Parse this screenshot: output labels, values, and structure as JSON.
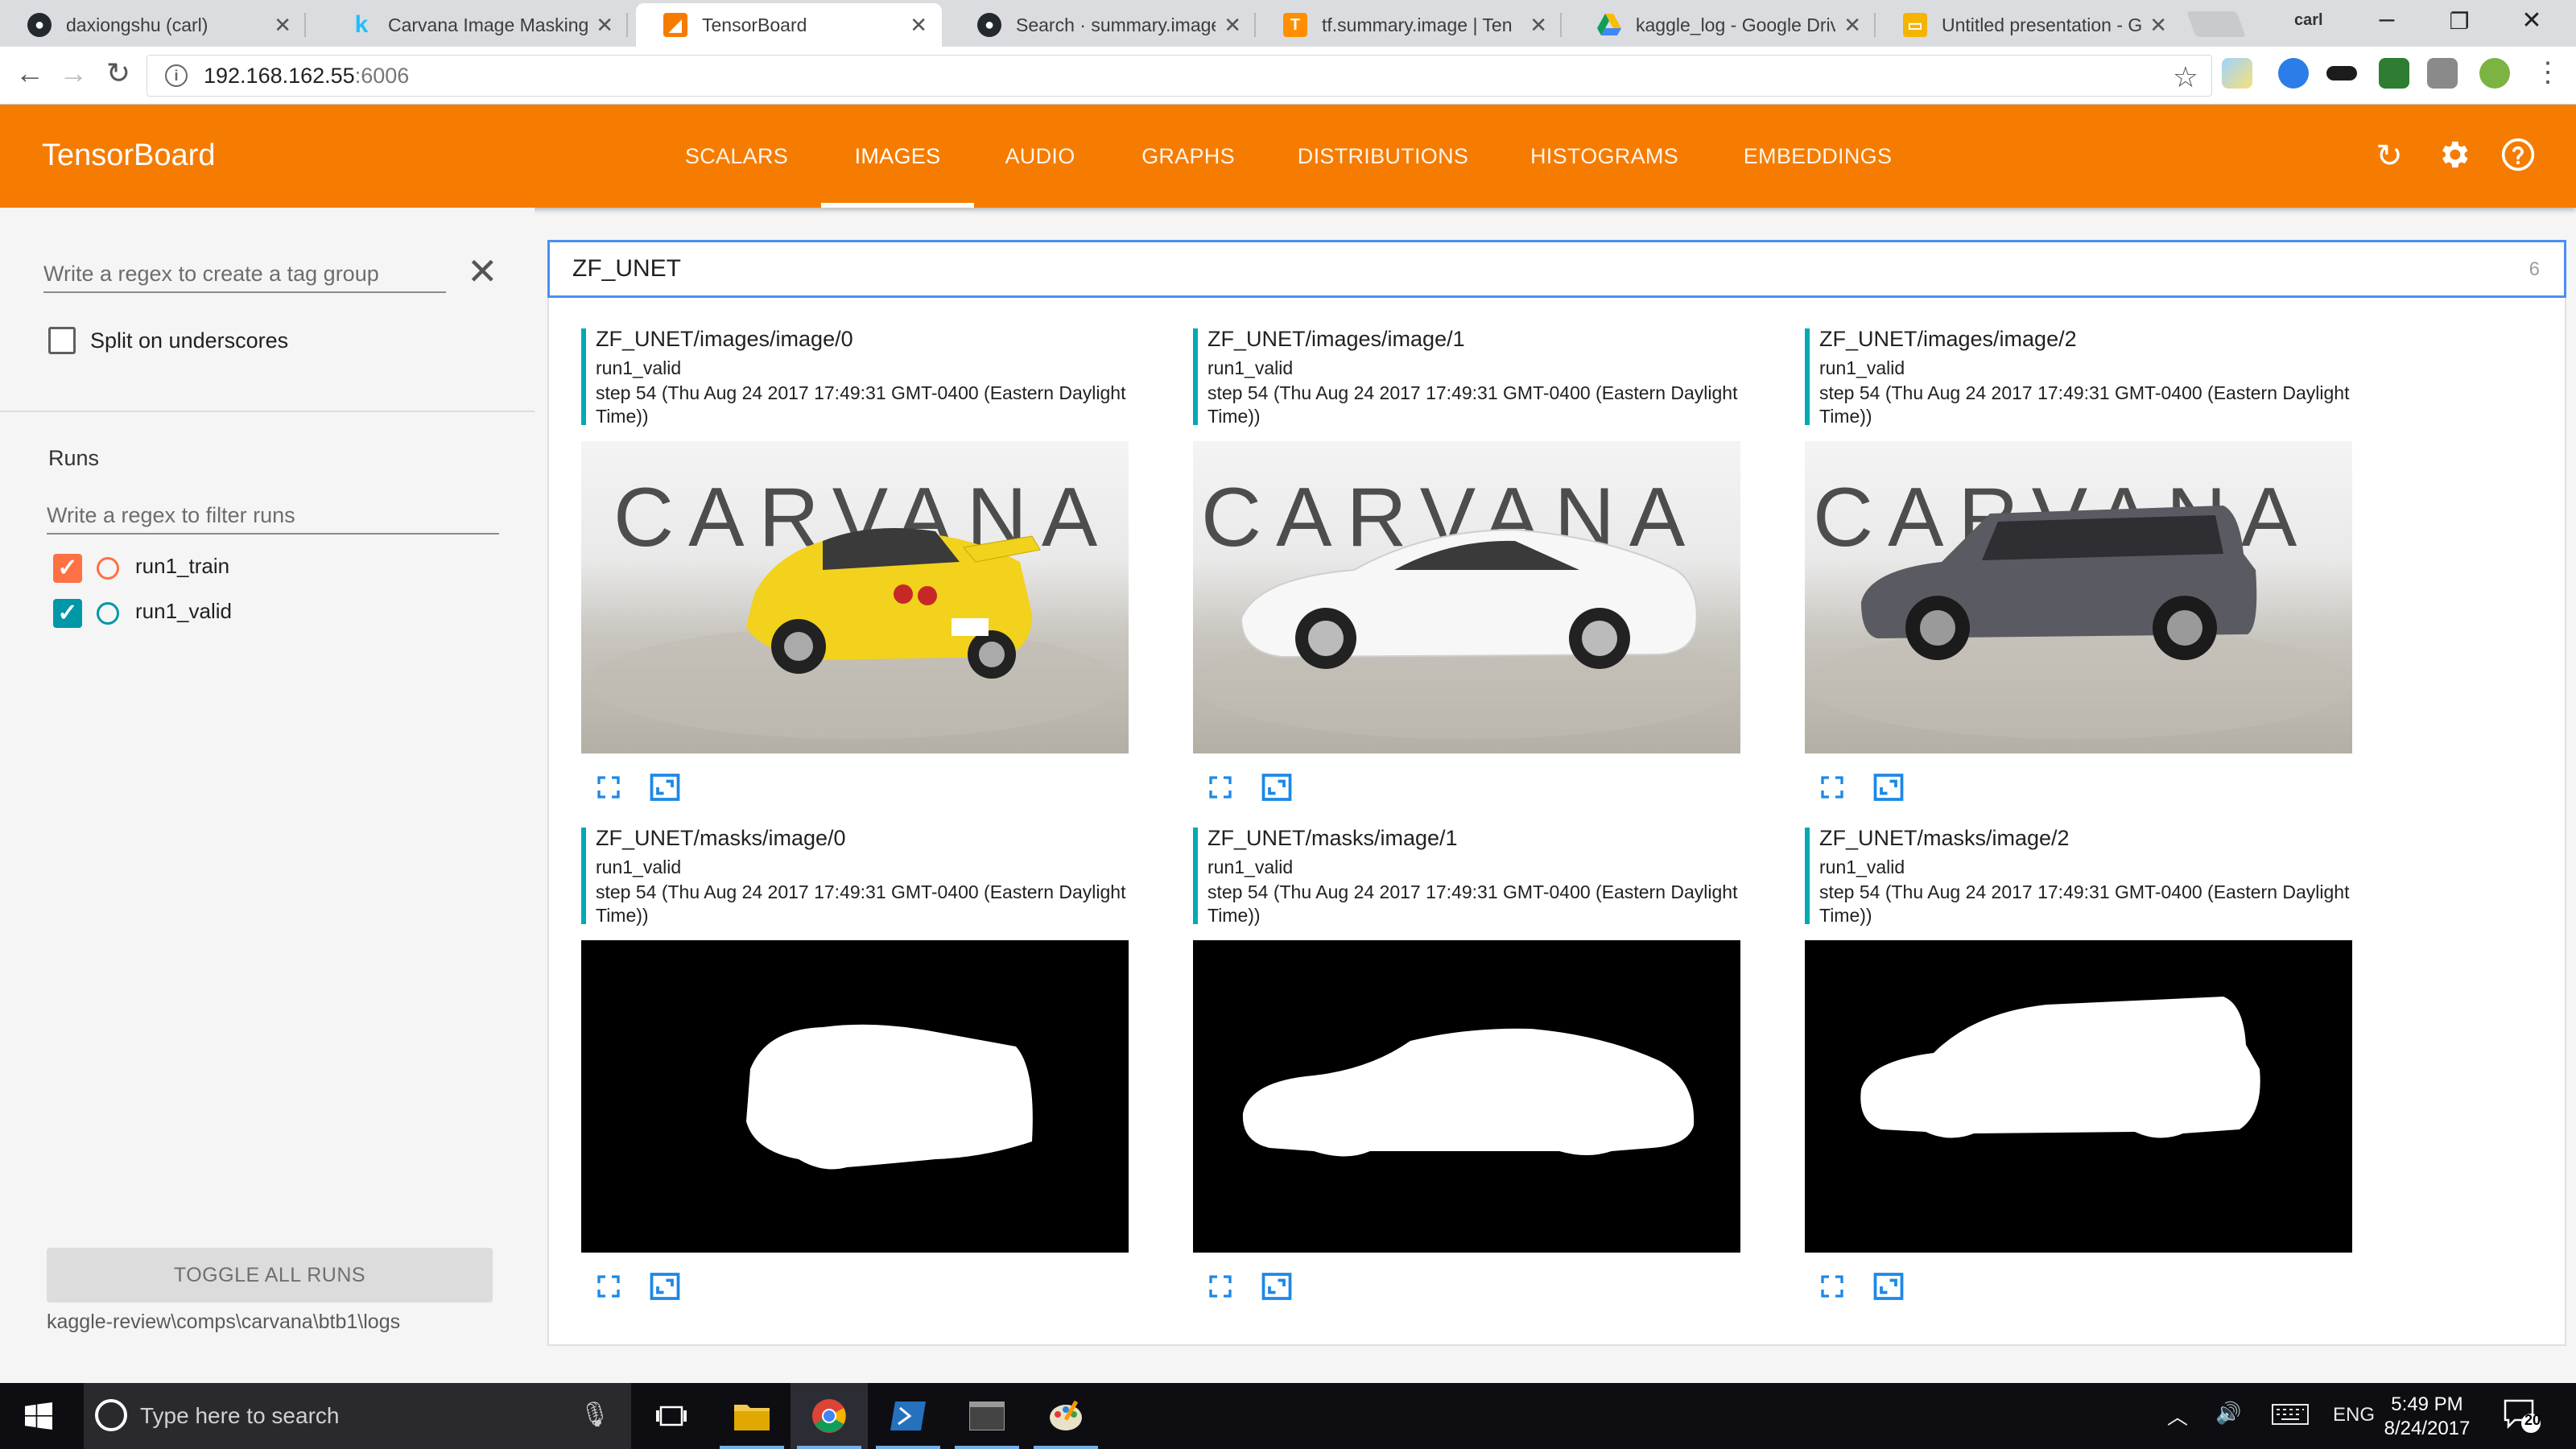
{
  "browser": {
    "tabs": [
      {
        "title": "daxiongshu (carl)",
        "icon": "github-icon"
      },
      {
        "title": "Carvana Image Masking",
        "icon": "kaggle-icon"
      },
      {
        "title": "TensorBoard",
        "icon": "tensorboard-icon"
      },
      {
        "title": "Search · summary.image",
        "icon": "github-icon"
      },
      {
        "title": "tf.summary.image | Ten",
        "icon": "tensorflow-icon"
      },
      {
        "title": "kaggle_log - Google Driv",
        "icon": "google-drive-icon"
      },
      {
        "title": "Untitled presentation - G",
        "icon": "google-slides-icon"
      }
    ],
    "active_tab": 2,
    "profile_name": "carl",
    "url_host": "192.168.162.55",
    "url_port": ":6006"
  },
  "tensorboard": {
    "title": "TensorBoard",
    "nav": [
      "SCALARS",
      "IMAGES",
      "AUDIO",
      "GRAPHS",
      "DISTRIBUTIONS",
      "HISTOGRAMS",
      "EMBEDDINGS"
    ],
    "active_nav": "IMAGES",
    "accent_color": "#f57c00"
  },
  "sidebar": {
    "tag_group_placeholder": "Write a regex to create a tag group",
    "split_label": "Split on underscores",
    "runs_title": "Runs",
    "runs_filter_placeholder": "Write a regex to filter runs",
    "runs": [
      {
        "name": "run1_train",
        "color": "#ff7043",
        "checked": true
      },
      {
        "name": "run1_valid",
        "color": "#0097a7",
        "checked": true
      }
    ],
    "toggle_all_label": "TOGGLE ALL RUNS",
    "logdir": "kaggle-review\\comps\\carvana\\btb1\\logs"
  },
  "main": {
    "tag_filter": "ZF_UNET",
    "tag_count": "6",
    "cards": [
      {
        "tag": "ZF_UNET/images/image/0",
        "run": "run1_valid",
        "step": "step 54 (Thu Aug 24 2017 17:49:31 GMT-0400 (Eastern Daylight Time))",
        "image": "yellow car rear three-quarter photo",
        "kind": "photo"
      },
      {
        "tag": "ZF_UNET/images/image/1",
        "run": "run1_valid",
        "step": "step 54 (Thu Aug 24 2017 17:49:31 GMT-0400 (Eastern Daylight Time))",
        "image": "white sedan side photo",
        "kind": "photo"
      },
      {
        "tag": "ZF_UNET/images/image/2",
        "run": "run1_valid",
        "step": "step 54 (Thu Aug 24 2017 17:49:31 GMT-0400 (Eastern Daylight Time))",
        "image": "gray SUV side photo",
        "kind": "photo"
      },
      {
        "tag": "ZF_UNET/masks/image/0",
        "run": "run1_valid",
        "step": "step 54 (Thu Aug 24 2017 17:49:31 GMT-0400 (Eastern Daylight Time))",
        "image": "car segmentation mask",
        "kind": "mask"
      },
      {
        "tag": "ZF_UNET/masks/image/1",
        "run": "run1_valid",
        "step": "step 54 (Thu Aug 24 2017 17:49:31 GMT-0400 (Eastern Daylight Time))",
        "image": "car segmentation mask",
        "kind": "mask"
      },
      {
        "tag": "ZF_UNET/masks/image/2",
        "run": "run1_valid",
        "step": "step 54 (Thu Aug 24 2017 17:49:31 GMT-0400 (Eastern Daylight Time))",
        "image": "car segmentation mask",
        "kind": "mask"
      }
    ],
    "watermark": "CARVANA"
  },
  "taskbar": {
    "search_placeholder": "Type here to search",
    "language": "ENG",
    "time": "5:49 PM",
    "date": "8/24/2017",
    "notifications": "20"
  }
}
